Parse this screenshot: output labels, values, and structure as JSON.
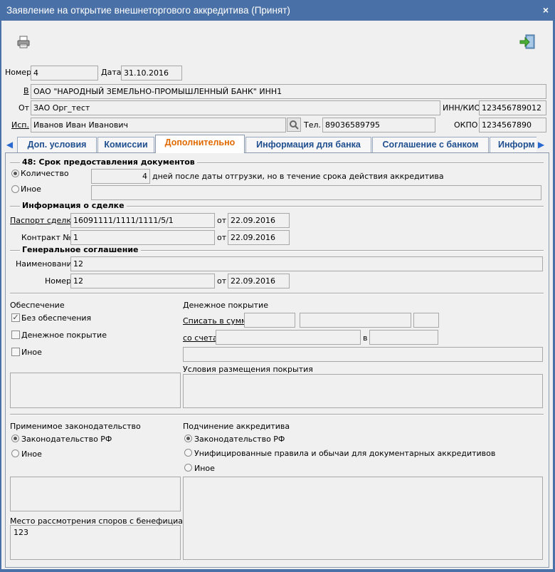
{
  "window": {
    "title": "Заявление на открытие внешнеторгового аккредитива (Принят)",
    "close_glyph": "×"
  },
  "toolbar": {
    "print_icon": "printer-icon",
    "exit_icon": "exit-door-icon"
  },
  "header": {
    "number_label": "Номер",
    "number_value": "4",
    "date_label": "Дата",
    "date_value": "31.10.2016",
    "to_label": "В",
    "to_value": "ОАО \"НАРОДНЫЙ ЗЕМЕЛЬНО-ПРОМЫШЛЕННЫЙ БАНК\" ИНН1",
    "from_label": "От",
    "from_value": "ЗАО Орг_тест",
    "inn_label": "ИНН/КИО",
    "inn_value": "123456789012",
    "executor_label": "Исп.",
    "executor_value": "Иванов Иван Иванович",
    "phone_label": "Тел.",
    "phone_value": "89036589795",
    "okpo_label": "ОКПО",
    "okpo_value": "1234567890"
  },
  "tabs": [
    {
      "label": "Доп. условия"
    },
    {
      "label": "Комиссии"
    },
    {
      "label": "Дополнительно"
    },
    {
      "label": "Информация для банка"
    },
    {
      "label": "Соглашение с банком"
    },
    {
      "label": "Информ"
    }
  ],
  "docs_term": {
    "title": "48: Срок предоставления документов",
    "quantity_label": "Количество",
    "quantity_value": "4",
    "quantity_suffix": "дней после даты отгрузки, но в течение срока действия аккредитива",
    "other_label": "Иное",
    "other_value": ""
  },
  "deal": {
    "title": "Информация о сделке",
    "passport_label": "Паспорт сделки",
    "passport_value": "16091111/1111/1111/5/1",
    "passport_from_label": "от",
    "passport_date": "22.09.2016",
    "contract_label": "Контракт №",
    "contract_value": "1",
    "contract_from_label": "от",
    "contract_date": "22.09.2016"
  },
  "general": {
    "title": "Генеральное соглашение",
    "name_label": "Наименование",
    "name_value": "12",
    "number_label": "Номер",
    "number_value": "12",
    "from_label": "от",
    "date_value": "22.09.2016"
  },
  "security": {
    "title": "Обеспечение",
    "none_label": "Без обеспечения",
    "money_label": "Денежное покрытие",
    "other_label": "Иное"
  },
  "coverage": {
    "title": "Денежное покрытие",
    "debit_label": "Списать в сумме",
    "account_label": "со счета",
    "in_label": "в",
    "conditions_label": "Условия размещения покрытия"
  },
  "law": {
    "title": "Применимое законодательство",
    "rf_label": "Законодательство РФ",
    "other_label": "Иное",
    "disputes_label": "Место рассмотрения споров с бенефициаром",
    "disputes_value": "123"
  },
  "subordination": {
    "title": "Подчинение аккредитива",
    "rf_label": "Законодательство РФ",
    "ucp_label": "Унифицированные правила и обычаи для документарных аккредитивов",
    "other_label": "Иное"
  },
  "colors": {
    "titlebar": "#4a71a7",
    "active_tab": "#e06a00",
    "tab_text": "#1f4f8f"
  }
}
